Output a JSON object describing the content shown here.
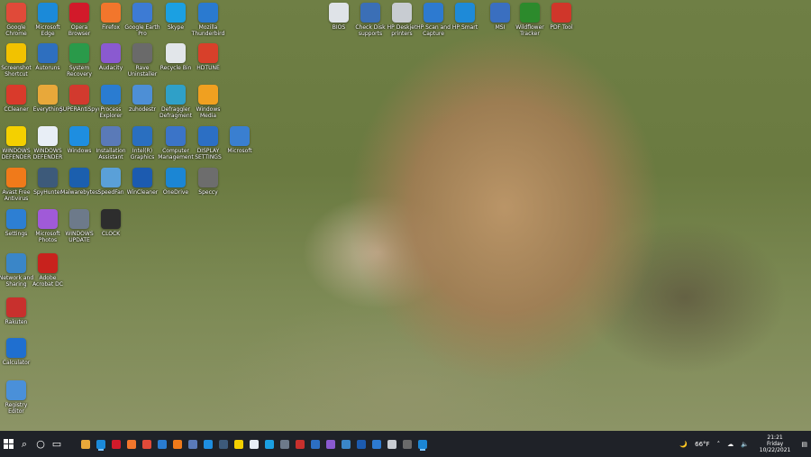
{
  "desktop": {
    "col1": [
      {
        "label": "Google Chrome",
        "icon": "chrome-icon",
        "color": "#e04a39"
      },
      {
        "label": "Screenshot Shortcut",
        "icon": "star-icon",
        "color": "#f2c200"
      },
      {
        "label": "CCleaner",
        "icon": "ccleaner-icon",
        "color": "#d93a2b"
      },
      {
        "label": "WINDOWS DEFENDER",
        "icon": "warning-icon",
        "color": "#f4d000"
      },
      {
        "label": "Avast Free Antivirus",
        "icon": "avast-icon",
        "color": "#f07a1a"
      },
      {
        "label": "Settings",
        "icon": "gear-icon",
        "color": "#2d7fd3"
      },
      {
        "label": "Network and Sharing",
        "icon": "network-icon",
        "color": "#3a86c8"
      },
      {
        "label": "Rakuten",
        "icon": "rakuten-icon",
        "color": "#c8302d"
      },
      {
        "label": "Calculator",
        "icon": "calculator-icon",
        "color": "#1f6fd0"
      },
      {
        "label": "Registry Editor",
        "icon": "registry-icon",
        "color": "#4a90d9"
      }
    ],
    "col2": [
      {
        "label": "Microsoft Edge",
        "icon": "edge-icon",
        "color": "#1b8ad9"
      },
      {
        "label": "Autoruns",
        "icon": "autoruns-icon",
        "color": "#2e6fbf"
      },
      {
        "label": "Everything",
        "icon": "everything-icon",
        "color": "#e8a83a"
      },
      {
        "label": "WINDOWS DEFENDER",
        "icon": "document-icon",
        "color": "#e8eef6"
      },
      {
        "label": "SpyHunter",
        "icon": "spyware-icon",
        "color": "#3d5a7a"
      },
      {
        "label": "Microsoft Photos",
        "icon": "photos-icon",
        "color": "#a05ad8"
      },
      {
        "label": "Adobe Acrobat DC",
        "icon": "acrobat-icon",
        "color": "#c8221d"
      }
    ],
    "col3": [
      {
        "label": "Opera Browser",
        "icon": "opera-icon",
        "color": "#d21a2a"
      },
      {
        "label": "System Recovery",
        "icon": "shield-icon",
        "color": "#2a9a4a"
      },
      {
        "label": "SUPERAntiSpyware",
        "icon": "superantispy-icon",
        "color": "#d23a2e"
      },
      {
        "label": "Windows",
        "icon": "windows-icon",
        "color": "#1e8ee0"
      },
      {
        "label": "Malwarebytes",
        "icon": "malwarebytes-icon",
        "color": "#1b5fae"
      },
      {
        "label": "WINDOWS UPDATE",
        "icon": "gear-icon",
        "color": "#6d7a8a"
      }
    ],
    "col4": [
      {
        "label": "Firefox",
        "icon": "firefox-icon",
        "color": "#f2762c"
      },
      {
        "label": "Audacity",
        "icon": "music-icon",
        "color": "#8a5ad0"
      },
      {
        "label": "Process Explorer",
        "icon": "search-icon",
        "color": "#2a7cd1"
      },
      {
        "label": "Installation Assistant",
        "icon": "disc-icon",
        "color": "#5a7ab8"
      },
      {
        "label": "SpeedFan",
        "icon": "speedfan-icon",
        "color": "#5aa0d8"
      },
      {
        "label": "CLOCK",
        "icon": "clock-icon",
        "color": "#2d2d2d"
      }
    ],
    "col5": [
      {
        "label": "Google Earth Pro",
        "icon": "earth-icon",
        "color": "#3d7bd4"
      },
      {
        "label": "Rave Uninstaller",
        "icon": "media-icon",
        "color": "#6a6a6a"
      },
      {
        "label": "zuhodestr",
        "icon": "gear-icon",
        "color": "#4d8fd6"
      },
      {
        "label": "Intel(R) Graphics",
        "icon": "display-icon",
        "color": "#2a6fc0"
      },
      {
        "label": "WinCleaner",
        "icon": "wincleaner-icon",
        "color": "#1c5bb0"
      }
    ],
    "col6": [
      {
        "label": "Skype",
        "icon": "skype-icon",
        "color": "#1ba0e2"
      },
      {
        "label": "Recycle Bin",
        "icon": "recycle-bin-icon",
        "color": "#e2e6ea"
      },
      {
        "label": "Defraggler Defragment",
        "icon": "defrag-icon",
        "color": "#2fa0c8"
      },
      {
        "label": "Computer Management",
        "icon": "computer-icon",
        "color": "#3b74c8"
      },
      {
        "label": "OneDrive",
        "icon": "onedrive-icon",
        "color": "#1b86d4"
      }
    ],
    "col7": [
      {
        "label": "Mozilla Thunderbird",
        "icon": "thunderbird-icon",
        "color": "#2a7ad0"
      },
      {
        "label": "HDTUNE",
        "icon": "power-icon",
        "color": "#d8402a"
      },
      {
        "label": "Windows Media",
        "icon": "media-player-icon",
        "color": "#f0a020"
      },
      {
        "label": "DISPLAY SETTINGS",
        "icon": "monitor-icon",
        "color": "#2c6fc4"
      },
      {
        "label": "Speccy",
        "icon": "speccy-icon",
        "color": "#6d6d6d"
      }
    ],
    "col8": [
      {
        "label": "Microsoft",
        "icon": "server-icon",
        "color": "#3a7fd0"
      }
    ],
    "toprow": [
      {
        "label": "BIOS",
        "icon": "bios-icon",
        "color": "#dfe3e8"
      },
      {
        "label": "Check Disk supports",
        "icon": "printer-icon",
        "color": "#3b6fb6"
      },
      {
        "label": "HP Deskjet printers",
        "icon": "printer-icon",
        "color": "#c8ccd2"
      },
      {
        "label": "HP Scan and Capture",
        "icon": "scanner-icon",
        "color": "#2d7ad0"
      },
      {
        "label": "HP Smart",
        "icon": "hp-icon",
        "color": "#1e8ad8"
      },
      {
        "label": "MSI",
        "icon": "msi-icon",
        "color": "#3a6fc0"
      },
      {
        "label": "Wildflower Tracker",
        "icon": "tree-icon",
        "color": "#2c8a2c"
      },
      {
        "label": "PDF Tool",
        "icon": "pdf-icon",
        "color": "#d0362a"
      }
    ]
  },
  "taskbar": {
    "start_icon": "windows-start-icon",
    "search_icon": "search-icon",
    "cortana_icon": "cortana-icon",
    "taskview_icon": "task-view-icon",
    "pinned_colors": [
      "#e8a83a",
      "#1b8ad9",
      "#d21a2a",
      "#f2762c",
      "#e04a39",
      "#2a7cd1",
      "#f07a1a",
      "#5a7ab8",
      "#1e8ee0",
      "#3d5a7a",
      "#f4d000",
      "#e8eef6",
      "#1ba0e2",
      "#6d7a8a",
      "#c8302d",
      "#2c6fc4",
      "#8a5ad0",
      "#3a86c8",
      "#1c5bb0",
      "#2d7ad0",
      "#c8ccd2",
      "#6a6a6a",
      "#1b86d4"
    ],
    "weather": "66°F",
    "time": "21:21",
    "day": "Friday",
    "date": "10/22/2021"
  }
}
